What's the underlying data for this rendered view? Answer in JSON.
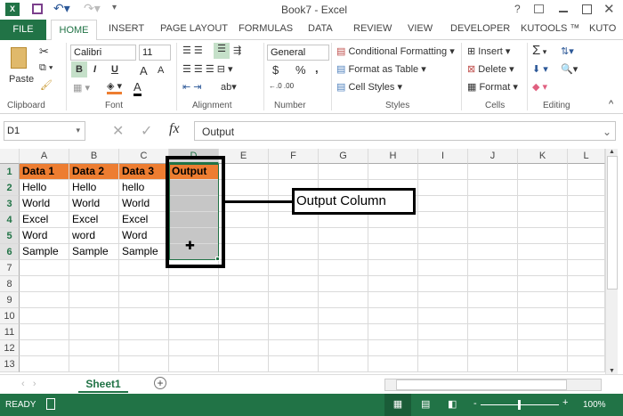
{
  "title": "Book7 - Excel",
  "window_controls": [
    "?",
    "restore-ribbon",
    "minimize",
    "maximize",
    "close"
  ],
  "tabs": [
    "FILE",
    "HOME",
    "INSERT",
    "PAGE LAYOUT",
    "FORMULAS",
    "DATA",
    "REVIEW",
    "VIEW",
    "DEVELOPER",
    "KUTOOLS ™",
    "KUTO"
  ],
  "active_tab": "HOME",
  "ribbon": {
    "clipboard": {
      "paste": "Paste",
      "label": "Clipboard"
    },
    "font": {
      "name": "Calibri",
      "size": "11",
      "bold": "B",
      "italic": "I",
      "underline": "U",
      "grow": "A",
      "shrink": "A",
      "color": "A",
      "label": "Font"
    },
    "alignment": {
      "label": "Alignment"
    },
    "number": {
      "format": "General",
      "currency": "$",
      "percent": "%",
      "comma": ",",
      "label": "Number"
    },
    "styles": {
      "conditional": "Conditional Formatting",
      "table": "Format as Table",
      "cell_styles": "Cell Styles",
      "label": "Styles"
    },
    "cells": {
      "insert": "Insert",
      "delete": "Delete",
      "format": "Format",
      "label": "Cells"
    },
    "editing": {
      "sum": "Σ",
      "label": "Editing"
    }
  },
  "formula_bar": {
    "name_box": "D1",
    "fx": "fx",
    "value": "Output"
  },
  "columns": [
    "A",
    "B",
    "C",
    "D",
    "E",
    "F",
    "G",
    "H",
    "I",
    "J",
    "K",
    "L"
  ],
  "rows": [
    "1",
    "2",
    "3",
    "4",
    "5",
    "6",
    "7",
    "8",
    "9",
    "10",
    "11",
    "12",
    "13"
  ],
  "cells": [
    [
      "Data 1",
      "Data 2",
      "Data 3",
      "Output"
    ],
    [
      "Hello",
      "Hello",
      "hello",
      ""
    ],
    [
      "World",
      "World",
      "World",
      ""
    ],
    [
      "Excel",
      "Excel",
      "Excel",
      ""
    ],
    [
      "Word",
      "word",
      "Word",
      ""
    ],
    [
      "Sample",
      "Sample",
      "Sample",
      ""
    ]
  ],
  "callout": "Output Column",
  "sheet_tab": "Sheet1",
  "status": {
    "ready": "READY",
    "zoom": "100%",
    "minus": "-",
    "plus": "+"
  },
  "colors": {
    "excel_green": "#217346",
    "header_orange": "#ed7d31",
    "selection": "#c6c6c6"
  }
}
